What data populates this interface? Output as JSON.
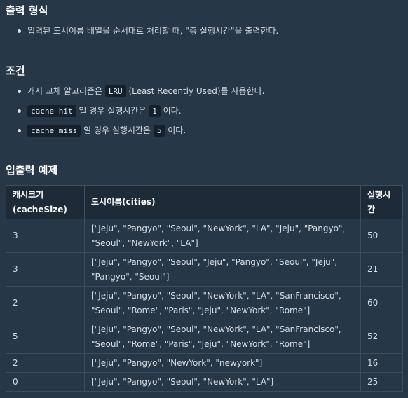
{
  "output_section": {
    "heading": "출력 형식",
    "items": [
      "입력된 도시이름 배열을 순서대로 처리할 때, \"총 실행시간\"을 출력한다."
    ]
  },
  "conditions_section": {
    "heading": "조건",
    "item1": {
      "before": "캐시 교체 알고리즘은 ",
      "code": "LRU",
      "after": " (Least Recently Used)를 사용한다."
    },
    "item2": {
      "code": "cache hit",
      "middle": " 일 경우 실행시간은 ",
      "code2": "1",
      "after": " 이다."
    },
    "item3": {
      "code": "cache miss",
      "middle": " 일 경우 실행시간은 ",
      "code2": "5",
      "after": " 이다."
    }
  },
  "examples_section": {
    "heading": "입출력 예제",
    "headers": [
      "캐시크기(cacheSize)",
      "도시이름(cities)",
      "실행시간"
    ],
    "rows": [
      {
        "cache_size": "3",
        "cities": "[\"Jeju\", \"Pangyo\", \"Seoul\", \"NewYork\", \"LA\", \"Jeju\", \"Pangyo\", \"Seoul\", \"NewYork\", \"LA\"]",
        "time": "50"
      },
      {
        "cache_size": "3",
        "cities": "[\"Jeju\", \"Pangyo\", \"Seoul\", \"Jeju\", \"Pangyo\", \"Seoul\", \"Jeju\", \"Pangyo\", \"Seoul\"]",
        "time": "21"
      },
      {
        "cache_size": "2",
        "cities": "[\"Jeju\", \"Pangyo\", \"Seoul\", \"NewYork\", \"LA\", \"SanFrancisco\", \"Seoul\", \"Rome\", \"Paris\", \"Jeju\", \"NewYork\", \"Rome\"]",
        "time": "60"
      },
      {
        "cache_size": "5",
        "cities": "[\"Jeju\", \"Pangyo\", \"Seoul\", \"NewYork\", \"LA\", \"SanFrancisco\", \"Seoul\", \"Rome\", \"Paris\", \"Jeju\", \"NewYork\", \"Rome\"]",
        "time": "52"
      },
      {
        "cache_size": "2",
        "cities": "[\"Jeju\", \"Pangyo\", \"NewYork\", \"newyork\"]",
        "time": "16"
      },
      {
        "cache_size": "0",
        "cities": "[\"Jeju\", \"Pangyo\", \"Seoul\", \"NewYork\", \"LA\"]",
        "time": "25"
      }
    ]
  }
}
